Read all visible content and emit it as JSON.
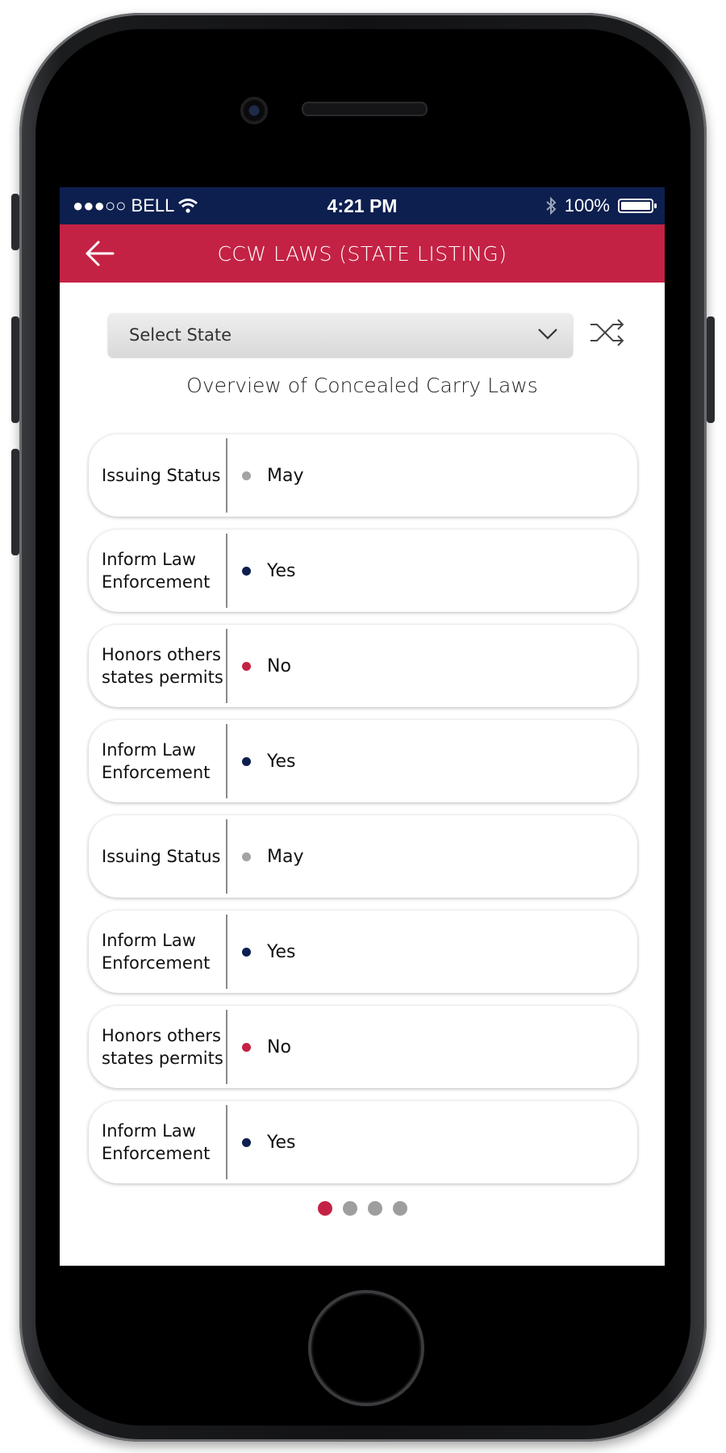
{
  "status_bar": {
    "carrier": "●●●○○ BELL",
    "time": "4:21 PM",
    "battery_pct": "100%"
  },
  "nav": {
    "title": "CCW LAWS (STATE LISTING)"
  },
  "select": {
    "placeholder": "Select State"
  },
  "overview_title": "Overview of Concealed Carry Laws",
  "status_colors": {
    "May": "#a3a3a3",
    "Yes": "#0d1f4f",
    "No": "#c42244"
  },
  "laws": [
    {
      "label": "Issuing Status",
      "value": "May"
    },
    {
      "label": "Inform Law Enforcement",
      "value": "Yes"
    },
    {
      "label": "Honors others states permits",
      "value": "No"
    },
    {
      "label": "Inform Law Enforcement",
      "value": "Yes"
    },
    {
      "label": "Issuing Status",
      "value": "May"
    },
    {
      "label": "Inform Law Enforcement",
      "value": "Yes"
    },
    {
      "label": "Honors others states permits",
      "value": "No"
    },
    {
      "label": "Inform Law Enforcement",
      "value": "Yes"
    }
  ],
  "pager": {
    "count": 4,
    "active": 0
  },
  "colors": {
    "accent": "#c42244",
    "navy": "#0d1f4f"
  }
}
